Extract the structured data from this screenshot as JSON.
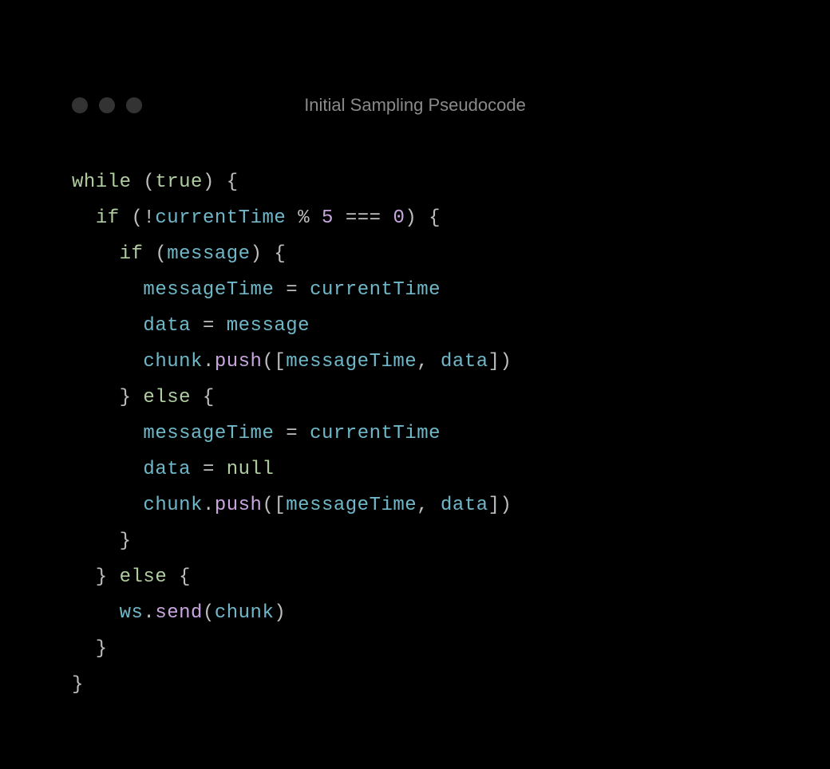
{
  "window": {
    "title": "Initial Sampling Pseudocode"
  },
  "code": {
    "tokens": [
      [
        {
          "t": "kw",
          "v": "while"
        },
        {
          "t": "pn",
          "v": " ("
        },
        {
          "t": "kw",
          "v": "true"
        },
        {
          "t": "pn",
          "v": ") {"
        }
      ],
      [
        {
          "t": "pn",
          "v": "  "
        },
        {
          "t": "kw",
          "v": "if"
        },
        {
          "t": "pn",
          "v": " ("
        },
        {
          "t": "op",
          "v": "!"
        },
        {
          "t": "ident",
          "v": "currentTime"
        },
        {
          "t": "pn",
          "v": " "
        },
        {
          "t": "op",
          "v": "%"
        },
        {
          "t": "pn",
          "v": " "
        },
        {
          "t": "num",
          "v": "5"
        },
        {
          "t": "pn",
          "v": " "
        },
        {
          "t": "op",
          "v": "==="
        },
        {
          "t": "pn",
          "v": " "
        },
        {
          "t": "num",
          "v": "0"
        },
        {
          "t": "pn",
          "v": ") {"
        }
      ],
      [
        {
          "t": "pn",
          "v": "    "
        },
        {
          "t": "kw",
          "v": "if"
        },
        {
          "t": "pn",
          "v": " ("
        },
        {
          "t": "ident",
          "v": "message"
        },
        {
          "t": "pn",
          "v": ") {"
        }
      ],
      [
        {
          "t": "pn",
          "v": "      "
        },
        {
          "t": "ident",
          "v": "messageTime"
        },
        {
          "t": "pn",
          "v": " "
        },
        {
          "t": "op",
          "v": "="
        },
        {
          "t": "pn",
          "v": " "
        },
        {
          "t": "ident",
          "v": "currentTime"
        }
      ],
      [
        {
          "t": "pn",
          "v": "      "
        },
        {
          "t": "ident",
          "v": "data"
        },
        {
          "t": "pn",
          "v": " "
        },
        {
          "t": "op",
          "v": "="
        },
        {
          "t": "pn",
          "v": " "
        },
        {
          "t": "ident",
          "v": "message"
        }
      ],
      [
        {
          "t": "pn",
          "v": "      "
        },
        {
          "t": "ident",
          "v": "chunk"
        },
        {
          "t": "pn",
          "v": "."
        },
        {
          "t": "fn",
          "v": "push"
        },
        {
          "t": "pn",
          "v": "(["
        },
        {
          "t": "ident",
          "v": "messageTime"
        },
        {
          "t": "pn",
          "v": ", "
        },
        {
          "t": "ident",
          "v": "data"
        },
        {
          "t": "pn",
          "v": "])"
        }
      ],
      [
        {
          "t": "pn",
          "v": "    } "
        },
        {
          "t": "kw",
          "v": "else"
        },
        {
          "t": "pn",
          "v": " {"
        }
      ],
      [
        {
          "t": "pn",
          "v": "      "
        },
        {
          "t": "ident",
          "v": "messageTime"
        },
        {
          "t": "pn",
          "v": " "
        },
        {
          "t": "op",
          "v": "="
        },
        {
          "t": "pn",
          "v": " "
        },
        {
          "t": "ident",
          "v": "currentTime"
        }
      ],
      [
        {
          "t": "pn",
          "v": "      "
        },
        {
          "t": "ident",
          "v": "data"
        },
        {
          "t": "pn",
          "v": " "
        },
        {
          "t": "op",
          "v": "="
        },
        {
          "t": "pn",
          "v": " "
        },
        {
          "t": "kw",
          "v": "null"
        }
      ],
      [
        {
          "t": "pn",
          "v": "      "
        },
        {
          "t": "ident",
          "v": "chunk"
        },
        {
          "t": "pn",
          "v": "."
        },
        {
          "t": "fn",
          "v": "push"
        },
        {
          "t": "pn",
          "v": "(["
        },
        {
          "t": "ident",
          "v": "messageTime"
        },
        {
          "t": "pn",
          "v": ", "
        },
        {
          "t": "ident",
          "v": "data"
        },
        {
          "t": "pn",
          "v": "])"
        }
      ],
      [
        {
          "t": "pn",
          "v": "    }"
        }
      ],
      [
        {
          "t": "pn",
          "v": "  } "
        },
        {
          "t": "kw",
          "v": "else"
        },
        {
          "t": "pn",
          "v": " {"
        }
      ],
      [
        {
          "t": "pn",
          "v": "    "
        },
        {
          "t": "ident",
          "v": "ws"
        },
        {
          "t": "pn",
          "v": "."
        },
        {
          "t": "fn",
          "v": "send"
        },
        {
          "t": "pn",
          "v": "("
        },
        {
          "t": "ident",
          "v": "chunk"
        },
        {
          "t": "pn",
          "v": ")"
        }
      ],
      [
        {
          "t": "pn",
          "v": "  }"
        }
      ],
      [
        {
          "t": "pn",
          "v": "}"
        }
      ]
    ]
  }
}
